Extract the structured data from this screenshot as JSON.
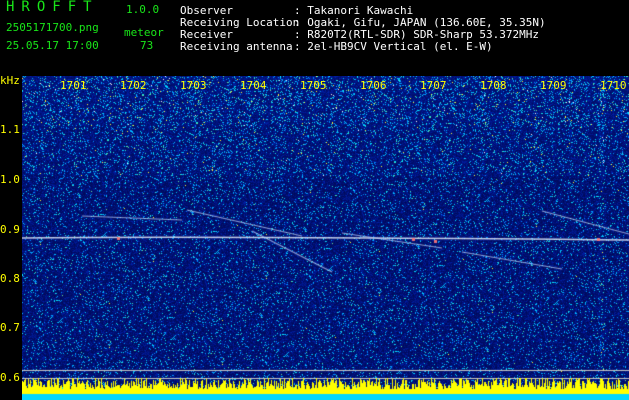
{
  "app": {
    "logo": "HROFFT",
    "version": "1.0.0"
  },
  "file": {
    "name": "2505171700.png",
    "datetime": "25.05.17 17:00"
  },
  "detection": {
    "label": "meteor",
    "count": "73"
  },
  "station": {
    "rows": [
      {
        "key": "Observer",
        "value": ": Takanori Kawachi"
      },
      {
        "key": "Receiving Location",
        "value": ": Ogaki, Gifu, JAPAN (136.60E, 35.35N)"
      },
      {
        "key": "Receiver",
        "value": ": R820T2(RTL-SDR) SDR-Sharp 53.372MHz"
      },
      {
        "key": "Receiving antenna",
        "value": ": 2el-HB9CV Vertical (el. E-W)"
      }
    ]
  },
  "axis": {
    "unit": "kHz",
    "y_ticks": [
      "1.1",
      "1.0",
      "0.9",
      "0.8",
      "0.7",
      "0.6"
    ],
    "x_ticks": [
      "1701",
      "1702",
      "1703",
      "1704",
      "1705",
      "1706",
      "1707",
      "1708",
      "1709",
      "1710"
    ]
  },
  "colors": {
    "background": "#000000",
    "logo": "#19e619",
    "axis_labels": "#ffff00",
    "noise_base": "#00128c",
    "trace": "#e8f0ff",
    "power_bar": "#ffff00",
    "baseline": "#00d8ff"
  }
}
